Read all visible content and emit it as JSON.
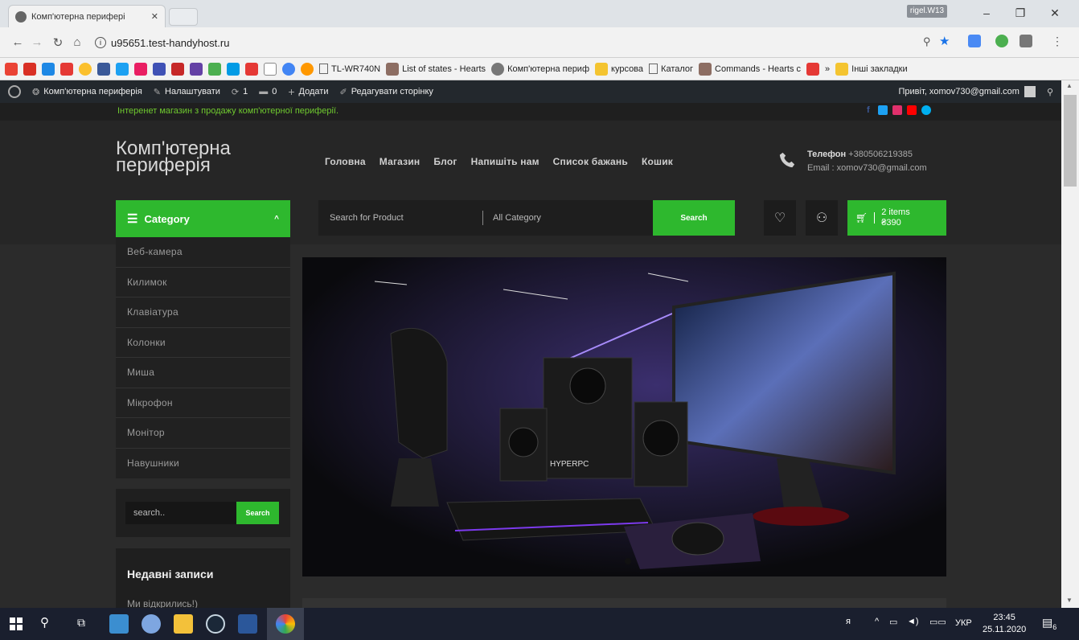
{
  "browser": {
    "tab_title": "Комп'ютерна перифері",
    "user_badge": "rigel.W13",
    "url": "u95651.test-handyhost.ru",
    "bookmarks": [
      "TL-WR740N",
      "List of states - Hearts",
      "Комп'ютерна периф",
      "курсова",
      "Каталог",
      "Commands - Hearts c"
    ],
    "other_bookmarks": "Інші закладки",
    "overflow": "»"
  },
  "wpbar": {
    "site": "Комп'ютерна периферія",
    "customize": "Налаштувати",
    "updates": "1",
    "comments": "0",
    "add": "Додати",
    "edit": "Редагувати сторінку",
    "greeting": "Привіт, xomov730@gmail.com"
  },
  "site": {
    "tagline": "Інтеренет магазин з продажу комп'ютерної периферії.",
    "logo_line1": "Комп'ютерна",
    "logo_line2": "периферія",
    "nav": [
      "Головна",
      "Магазин",
      "Блог",
      "Напишіть нам",
      "Список бажань",
      "Кошик"
    ],
    "phone_label": "Телефон",
    "phone": "+380506219385",
    "email": "Email : xomov730@gmail.com",
    "category_btn": "Category",
    "search_placeholder": "Search for Product",
    "all_category": "All Category",
    "search_btn": "Search",
    "cart_items": "2 items",
    "cart_total": "₴390",
    "categories": [
      "Веб-камера",
      "Килимок",
      "Клавіатура",
      "Колонки",
      "Миша",
      "Мікрофон",
      "Монітор",
      "Навушники"
    ],
    "side_search_placeholder": "search..",
    "side_search_btn": "Search",
    "recent_title": "Недавні записи",
    "recent_post": "Ми відкрились!)",
    "hero_brand": "HYPERPC"
  },
  "taskbar": {
    "lang": "УКР",
    "time": "23:45",
    "date": "25.11.2020",
    "notif": "6"
  },
  "colors": {
    "accent": "#2eb82e",
    "tagline": "#6fc92f"
  }
}
